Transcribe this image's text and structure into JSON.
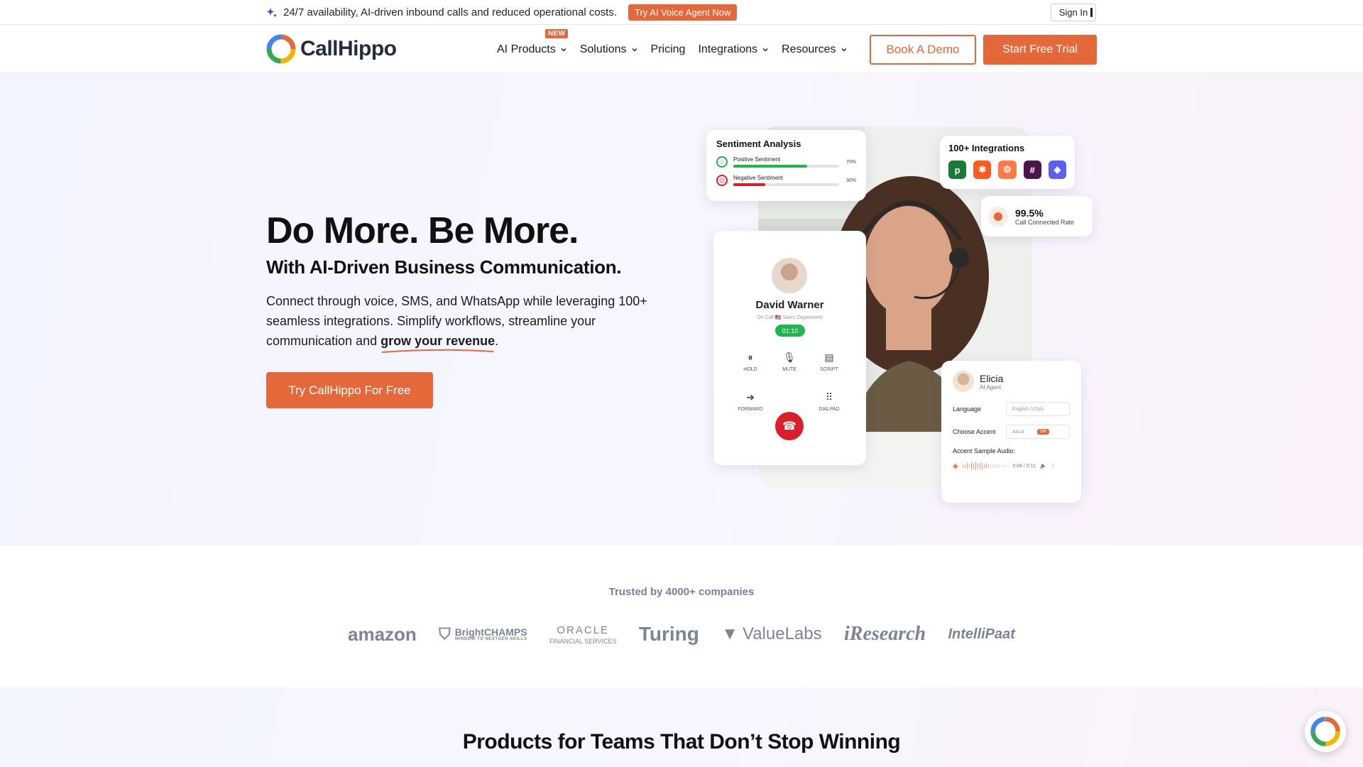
{
  "topbar": {
    "text": "24/7 availability, AI-driven inbound calls and reduced operational costs.",
    "cta": "Try AI Voice Agent Now",
    "signin": "Sign In"
  },
  "nav": {
    "brand": "CallHippo",
    "new_badge": "NEW",
    "items": [
      {
        "label": "AI Products",
        "dropdown": true
      },
      {
        "label": "Solutions",
        "dropdown": true
      },
      {
        "label": "Pricing",
        "dropdown": false
      },
      {
        "label": "Integrations",
        "dropdown": true
      },
      {
        "label": "Resources",
        "dropdown": true
      }
    ],
    "book_demo": "Book A Demo",
    "free_trial": "Start Free Trial"
  },
  "hero": {
    "title": "Do More. Be More.",
    "subtitle": "With AI-Driven Business Communication.",
    "desc_before": "Connect through voice, SMS, and WhatsApp while leveraging 100+ seamless integrations. Simplify workflows, streamline your communication and ",
    "desc_highlight": "grow your revenue",
    "desc_after": ".",
    "cta": "Try CallHippo For Free"
  },
  "sentiment": {
    "title": "Sentiment Analysis",
    "rows": [
      {
        "label": "Positive Sentiment",
        "pct": "70%",
        "value": 0.7,
        "color": "#1fb650"
      },
      {
        "label": "Negative Sentiment",
        "pct": "30%",
        "value": 0.3,
        "color": "#d91f2a"
      }
    ]
  },
  "integrations": {
    "title": "100+ Integrations",
    "icons": [
      {
        "name": "pipedrive-icon",
        "glyph": "p",
        "color": "#1a7a3a"
      },
      {
        "name": "zapier-icon",
        "glyph": "✱",
        "color": "#ff5a1f"
      },
      {
        "name": "hubspot-icon",
        "glyph": "⚙",
        "color": "#ff7a45"
      },
      {
        "name": "slack-icon",
        "glyph": "#",
        "color": "#4a154b"
      },
      {
        "name": "shield-app-icon",
        "glyph": "◈",
        "color": "#5b5ff0"
      }
    ]
  },
  "rate": {
    "value": "99.5%",
    "label": "Call Connected Rate"
  },
  "call": {
    "name": "David Warner",
    "meta": "On Call  🇺🇸  Sales Department",
    "timer": "01:10",
    "actions": [
      "HOLD",
      "MUTE",
      "SCRIPT",
      "FORWARD",
      "DIALPAD"
    ]
  },
  "agent": {
    "name": "Elicia",
    "role": "AI Agent",
    "language_label": "Language",
    "language_value": "English (USA)",
    "accent_label": "Choose Accent",
    "accent_value": "Alicia",
    "accent_pill": "ON",
    "audio_label": "Accent Sample Audio:",
    "audio_time": "0:04 / 0:11"
  },
  "trusted": {
    "title": "Trusted by 4000+ companies",
    "companies": [
      "amazon",
      "BrightCHAMPS",
      "ORACLE",
      "Turing",
      "ValueLabs",
      "iResearch",
      "IntelliPaat"
    ],
    "brightchamps_tag": "WINDOW TO NEXTGEN SKILLS",
    "oracle_tag": "FINANCIAL SERVICES"
  },
  "products": {
    "title": "Products for Teams That Don’t Stop Winning"
  },
  "colors": {
    "accent": "#e5683a",
    "green": "#1fb650",
    "red": "#d91f2a"
  }
}
